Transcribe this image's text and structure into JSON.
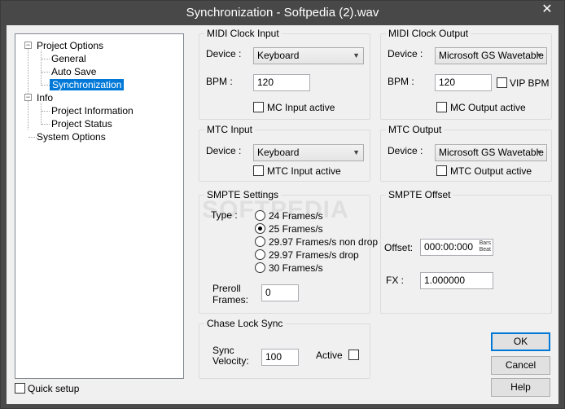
{
  "window": {
    "title": "Synchronization - Softpedia (2).wav",
    "close_glyph": "✕"
  },
  "tree": {
    "project_options": "Project Options",
    "general": "General",
    "auto_save": "Auto Save",
    "synchronization": "Synchronization",
    "info": "Info",
    "project_information": "Project Information",
    "project_status": "Project Status",
    "system_options": "System Options",
    "expander_glyph": "−"
  },
  "quick_setup": {
    "label": "Quick setup"
  },
  "midi_clock_input": {
    "title": "MIDI Clock Input",
    "device_label": "Device :",
    "device_value": "Keyboard",
    "bpm_label": "BPM :",
    "bpm_value": "120",
    "active_label": "MC Input active"
  },
  "midi_clock_output": {
    "title": "MIDI Clock Output",
    "device_label": "Device :",
    "device_value": "Microsoft GS Wavetable",
    "bpm_label": "BPM :",
    "bpm_value": "120",
    "vip_label": "VIP BPM",
    "active_label": "MC Output active"
  },
  "mtc_input": {
    "title": "MTC Input",
    "device_label": "Device :",
    "device_value": "Keyboard",
    "active_label": "MTC Input active"
  },
  "mtc_output": {
    "title": "MTC Output",
    "device_label": "Device :",
    "device_value": "Microsoft GS Wavetable",
    "active_label": "MTC Output active"
  },
  "smpte_settings": {
    "title": "SMPTE Settings",
    "type_label": "Type :",
    "options": [
      "24 Frames/s",
      "25 Frames/s",
      "29.97 Frames/s non drop",
      "29.97 Frames/s drop",
      "30 Frames/s"
    ],
    "selected": "25 Frames/s",
    "preroll_label_1": "Preroll",
    "preroll_label_2": "Frames:",
    "preroll_value": "0"
  },
  "smpte_offset": {
    "title": "SMPTE Offset",
    "offset_label": "Offset:",
    "offset_value": "000:00:000",
    "bars_label": "Bars",
    "beat_label": "Beat",
    "fx_label": "FX :",
    "fx_value": "1.000000"
  },
  "chase_lock": {
    "title": "Chase Lock Sync",
    "sync_label_1": "Sync",
    "sync_label_2": "Velocity:",
    "sync_value": "100",
    "active_label": "Active"
  },
  "buttons": {
    "ok": "OK",
    "cancel": "Cancel",
    "help": "Help"
  },
  "watermark": "SOFTPEDIA",
  "icons": {
    "dropdown": "chevron-down-icon"
  },
  "colors": {
    "selection": "#0078d7",
    "titlebar": "#484848"
  }
}
